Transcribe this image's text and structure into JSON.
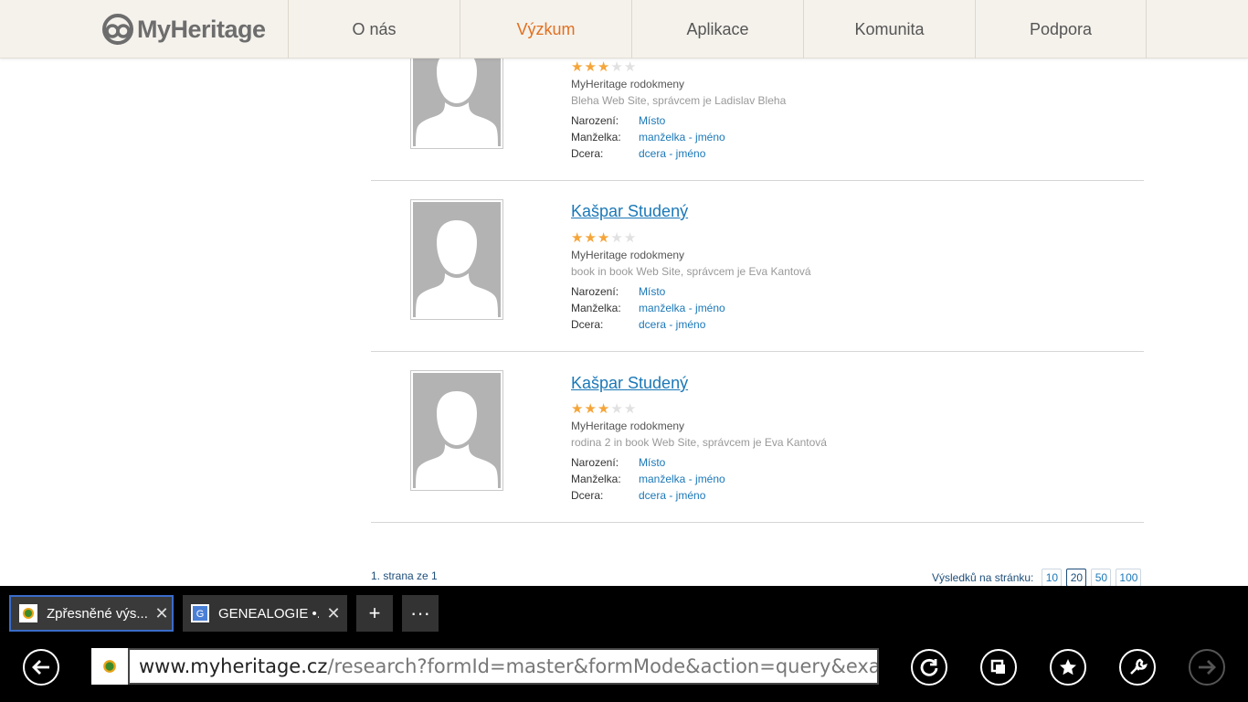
{
  "site": {
    "logo_text": "MyHeritage",
    "nav": [
      {
        "label": "O nás",
        "active": false
      },
      {
        "label": "Výzkum",
        "active": true
      },
      {
        "label": "Aplikace",
        "active": false
      },
      {
        "label": "Komunita",
        "active": false
      },
      {
        "label": "Podpora",
        "active": false
      }
    ]
  },
  "results": [
    {
      "name": "",
      "rating": 3,
      "rating_max": 5,
      "source": "MyHeritage rodokmeny",
      "site": "Bleha Web Site, správcem je Ladislav Bleha",
      "relations": [
        {
          "label": "Narození:",
          "value": "Místo"
        },
        {
          "label": "Manželka:",
          "value": "manželka - jméno"
        },
        {
          "label": "Dcera:",
          "value": "dcera - jméno"
        }
      ]
    },
    {
      "name": "Kašpar Studený",
      "rating": 3,
      "rating_max": 5,
      "source": "MyHeritage rodokmeny",
      "site": "book in book Web Site, správcem je Eva Kantová",
      "relations": [
        {
          "label": "Narození:",
          "value": "Místo"
        },
        {
          "label": "Manželka:",
          "value": "manželka - jméno"
        },
        {
          "label": "Dcera:",
          "value": "dcera - jméno"
        }
      ]
    },
    {
      "name": "Kašpar Studený",
      "rating": 3,
      "rating_max": 5,
      "source": "MyHeritage rodokmeny",
      "site": "rodina 2 in book Web Site, správcem je Eva Kantová",
      "relations": [
        {
          "label": "Narození:",
          "value": "Místo"
        },
        {
          "label": "Manželka:",
          "value": "manželka - jméno"
        },
        {
          "label": "Dcera:",
          "value": "dcera - jméno"
        }
      ]
    }
  ],
  "pager": {
    "page_text": "1. strana ze 1",
    "per_page_label": "Výsledků na stránku:",
    "options": [
      "10",
      "20",
      "50",
      "100"
    ],
    "selected": "20"
  },
  "browser": {
    "tabs": [
      {
        "title": "Zpřesněné výs...",
        "active": true,
        "favicon": "myheritage-favicon"
      },
      {
        "title": "GENEALOGIE •...",
        "active": false,
        "favicon": "google-favicon"
      }
    ],
    "new_tab_label": "+",
    "more_label": "···",
    "url_host": "www.myheritage.cz",
    "url_path": "/research?formId=master&formMode&action=query&exactSearch="
  },
  "colors": {
    "link": "#1b78b8",
    "nav_active": "#e2701f",
    "star_on": "#f5a53a",
    "star_off": "#e1e1e1"
  }
}
